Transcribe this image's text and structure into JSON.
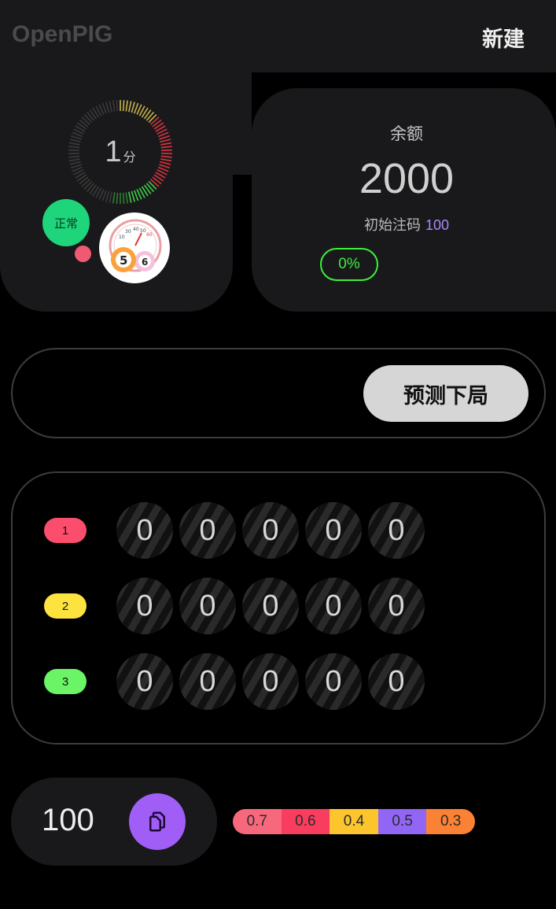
{
  "header": {
    "title": "OpenPIG",
    "new_label": "新建"
  },
  "timer": {
    "value": "1",
    "unit": "分"
  },
  "status": {
    "label": "正常"
  },
  "balance": {
    "label": "余额",
    "value": "2000",
    "initial_label": "初始注码",
    "initial_value": "100",
    "change_pct": "0%"
  },
  "predict": {
    "button_label": "预测下局"
  },
  "rows": [
    {
      "label": "1",
      "color": "#fb4e6d",
      "values": [
        "0",
        "0",
        "0",
        "0",
        "0"
      ]
    },
    {
      "label": "2",
      "color": "#fde33f",
      "values": [
        "0",
        "0",
        "0",
        "0",
        "0"
      ]
    },
    {
      "label": "3",
      "color": "#6af466",
      "values": [
        "0",
        "0",
        "0",
        "0",
        "0"
      ]
    }
  ],
  "bet": {
    "value": "100",
    "copy_icon": "copy-icon"
  },
  "ratios": [
    {
      "value": "0.7",
      "color": "#f8687d"
    },
    {
      "value": "0.6",
      "color": "#f93d5e"
    },
    {
      "value": "0.4",
      "color": "#fcc52e"
    },
    {
      "value": "0.5",
      "color": "#9266f4"
    },
    {
      "value": "0.3",
      "color": "#fb8134"
    }
  ],
  "colors": {
    "accent_purple": "#a15ef7",
    "status_green": "#1fd57b",
    "positive_green": "#3cf03c",
    "alert_red": "#ef5a72"
  }
}
